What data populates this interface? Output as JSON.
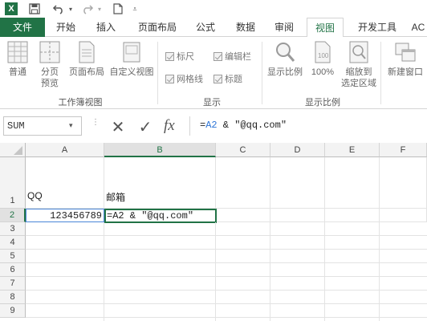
{
  "quick_access": {
    "app_icon": "excel-logo-icon",
    "app_letter": "X",
    "icons": [
      "save-icon",
      "undo-icon",
      "redo-icon",
      "new-document-icon",
      "customize-icon"
    ]
  },
  "tabs": [
    {
      "label": "文件",
      "state": "file"
    },
    {
      "label": "开始"
    },
    {
      "label": "插入"
    },
    {
      "label": "页面布局"
    },
    {
      "label": "公式"
    },
    {
      "label": "数据"
    },
    {
      "label": "审阅"
    },
    {
      "label": "视图",
      "state": "active"
    },
    {
      "label": "开发工具"
    },
    {
      "label": "AC"
    }
  ],
  "ribbon": {
    "workbook_views": {
      "normal": "普通",
      "page_break_line1": "分页",
      "page_break_line2": "预览",
      "page_layout": "页面布局",
      "custom_views": "自定义视图",
      "group_label": "工作簿视图"
    },
    "show": {
      "ruler": "标尺",
      "formula_bar": "编辑栏",
      "gridlines": "网格线",
      "headings": "标题",
      "group_label": "显示"
    },
    "zoom": {
      "zoom": "显示比例",
      "hundred": "100%",
      "zoom_sel_line1": "缩放到",
      "zoom_sel_line2": "选定区域",
      "group_label": "显示比例"
    },
    "window": {
      "new_window": "新建窗口"
    }
  },
  "formula_bar": {
    "name_box": "SUM",
    "cancel_symbol": "✕",
    "enter_symbol": "✓",
    "fx_symbol": "fx",
    "formula_prefix": "=",
    "formula_ref": "A2",
    "formula_rest": " & \"@qq.com\""
  },
  "columns": [
    "A",
    "B",
    "C",
    "D",
    "E",
    "F"
  ],
  "rows": [
    "1",
    "2",
    "3",
    "4",
    "5",
    "6",
    "7",
    "8",
    "9"
  ],
  "cells": {
    "A_header_text": "QQ",
    "B_header_text": "邮箱",
    "A2": "123456789",
    "B2": "=A2 & \"@qq.com\""
  },
  "colors": {
    "brand_green": "#217346",
    "ref_blue": "#2e75d6"
  }
}
